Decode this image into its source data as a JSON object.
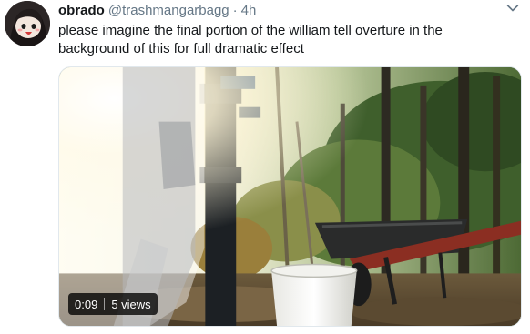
{
  "tweet": {
    "display_name": "obrado",
    "handle": "@trashmangarbagg",
    "separator": "·",
    "timestamp": "4h",
    "text": "please imagine the final portion of the william tell overture in the background of this for full dramatic effect"
  },
  "video": {
    "duration": "0:09",
    "views": "5 views"
  },
  "icons": {
    "menu": "chevron-down-icon"
  },
  "colors": {
    "name_text": "#14171a",
    "secondary_text": "#657786",
    "border": "#e1e8ed"
  }
}
